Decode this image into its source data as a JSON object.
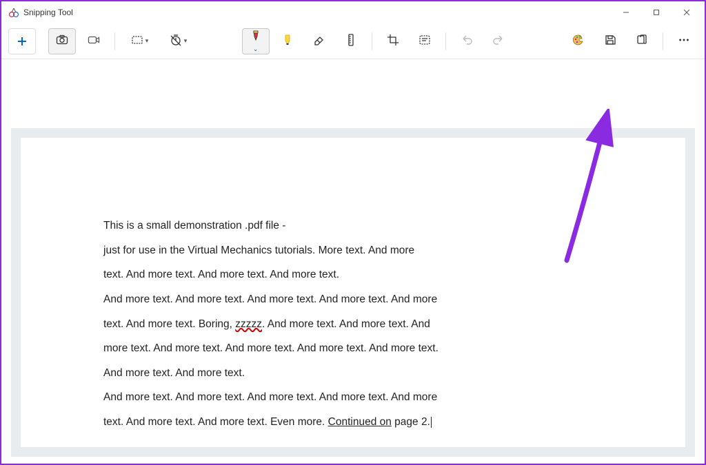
{
  "window": {
    "title": "Snipping Tool"
  },
  "toolbar": {
    "new": "New",
    "camera": "Snip",
    "video": "Record",
    "rect": "Rectangle mode",
    "delay": "Delay",
    "pen": "Ballpoint pen",
    "highlighter": "Highlighter",
    "eraser": "Eraser",
    "ruler": "Ruler",
    "crop": "Crop",
    "textactions": "Text actions",
    "undo": "Undo",
    "redo": "Redo",
    "editpaint": "Edit in Paint",
    "save": "Save",
    "copy": "Copy",
    "more": "See more"
  },
  "document": {
    "line1": "This is a small demonstration .pdf file -",
    "line2a": "just for use in the Virtual Mechanics tutorials. More text. And more",
    "line2b": "text. And more text. And more text. And more text.",
    "line3a": "And more text. And more text. And more text. And more text. And more",
    "line3b_pre": "text. And more text. Boring, ",
    "line3b_err": "zzzzz",
    "line3b_post": ". And more text. And more text. And",
    "line3c": "more text. And more text. And more text. And more text. And more text.",
    "line3d": "And more text. And more text.",
    "line4a": "And more text. And more text. And more text. And more text. And more",
    "line4b_pre": "text. And more text. And more text. Even more. ",
    "line4b_link": "Continued on",
    "line4b_post": " page 2."
  }
}
